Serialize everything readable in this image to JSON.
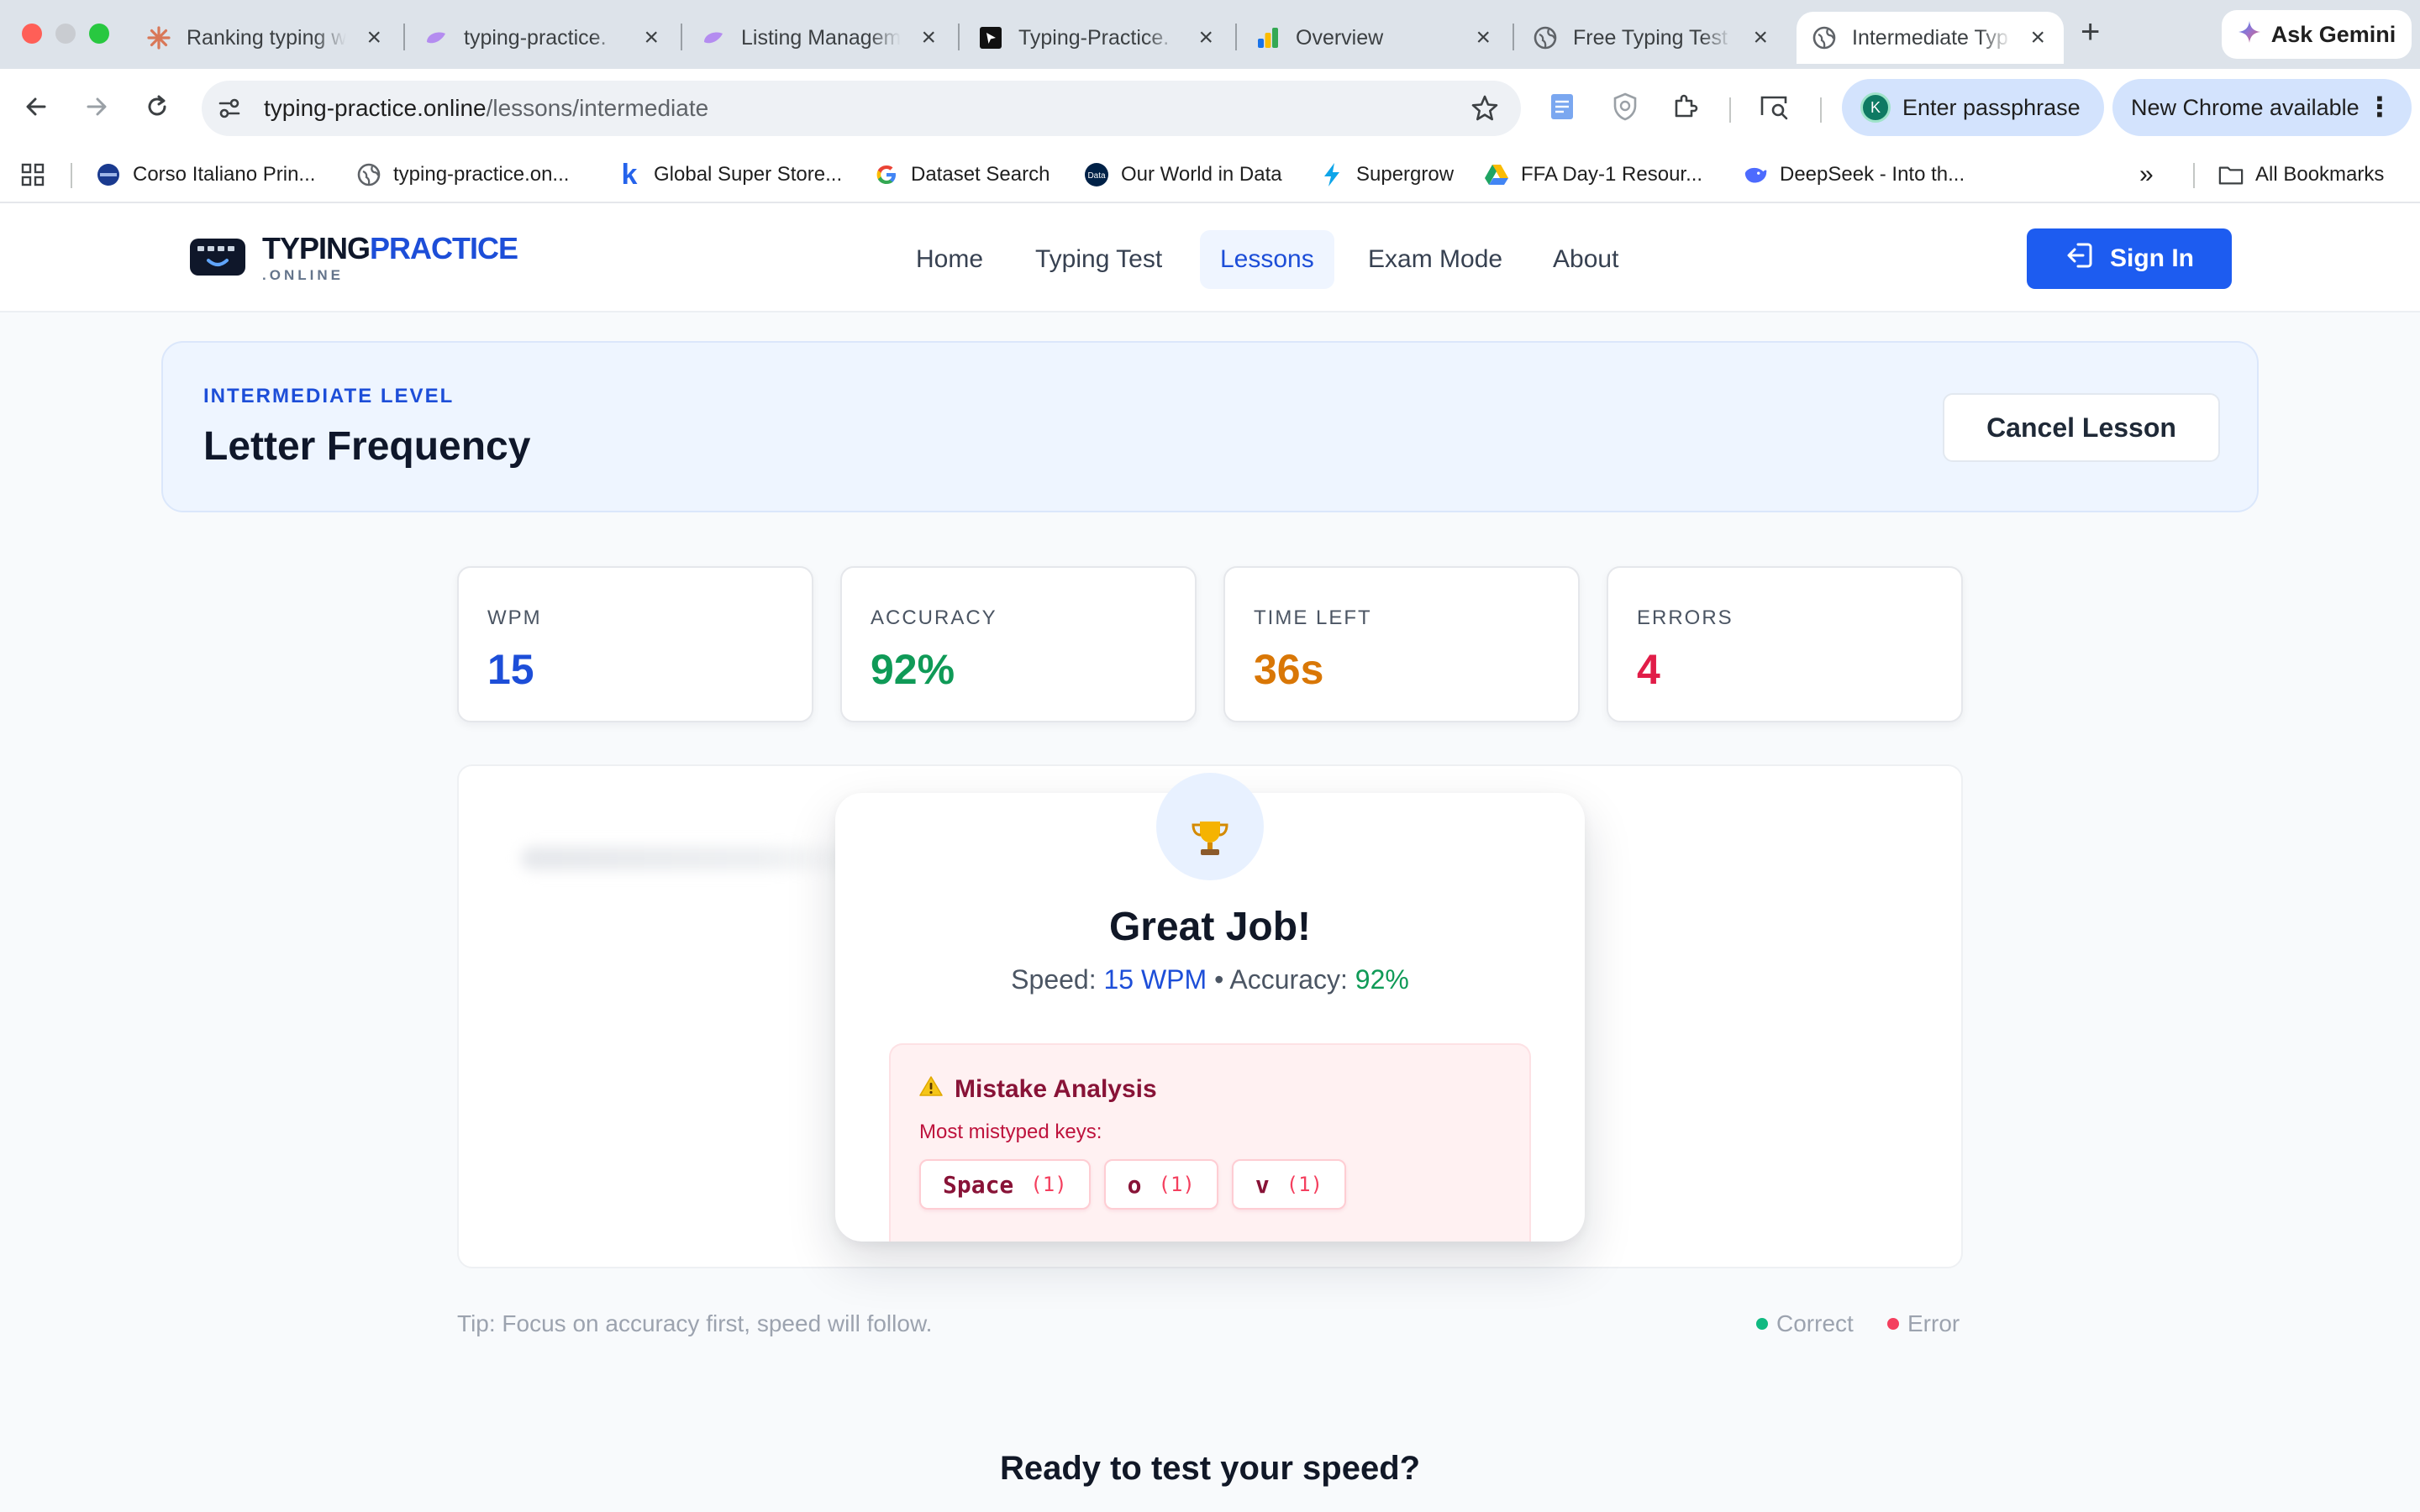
{
  "browser": {
    "tabs": [
      {
        "title": "Ranking typing w",
        "icon": "claude-burst-icon"
      },
      {
        "title": "typing-practice.",
        "icon": "lovable-icon"
      },
      {
        "title": "Listing Managem",
        "icon": "lovable-icon"
      },
      {
        "title": "Typing-Practice.",
        "icon": "cursor-icon"
      },
      {
        "title": "Overview",
        "icon": "analytics-icon"
      },
      {
        "title": "Free Typing Test",
        "icon": "globe-icon"
      },
      {
        "title": "Intermediate Typ",
        "icon": "globe-icon",
        "active": true
      }
    ],
    "gemini_label": "Ask Gemini",
    "url_host": "typing-practice.online",
    "url_path": "/lessons/intermediate",
    "passphrase_label": "Enter passphrase",
    "profile_initial": "K",
    "update_label": "New Chrome available",
    "bookmarks": [
      {
        "label": "Corso Italiano Prin...",
        "icon": "blue-circle-icon"
      },
      {
        "label": "typing-practice.on...",
        "icon": "globe-icon"
      },
      {
        "label": "Global Super Store...",
        "icon": "k-icon"
      },
      {
        "label": "Dataset Search",
        "icon": "google-icon"
      },
      {
        "label": "Our World in Data",
        "icon": "owid-icon"
      },
      {
        "label": "Supergrow",
        "icon": "bolt-icon"
      },
      {
        "label": "FFA Day-1 Resour...",
        "icon": "drive-icon"
      },
      {
        "label": "DeepSeek - Into th...",
        "icon": "whale-icon"
      }
    ],
    "all_bookmarks_label": "All Bookmarks"
  },
  "site": {
    "logo_part1": "TYPING",
    "logo_part2": "PRACTICE",
    "logo_sub": ".ONLINE",
    "nav": [
      "Home",
      "Typing Test",
      "Lessons",
      "Exam Mode",
      "About"
    ],
    "active_nav": "Lessons",
    "signin_label": "Sign In"
  },
  "lesson": {
    "level": "INTERMEDIATE LEVEL",
    "title": "Letter Frequency",
    "cancel_label": "Cancel Lesson"
  },
  "stats": [
    {
      "label": "WPM",
      "value": "15",
      "color": "#1d4ed8"
    },
    {
      "label": "ACCURACY",
      "value": "92%",
      "color": "#0f9a57"
    },
    {
      "label": "TIME LEFT",
      "value": "36s",
      "color": "#d97706"
    },
    {
      "label": "ERRORS",
      "value": "4",
      "color": "#e11d48"
    }
  ],
  "result": {
    "heading": "Great Job!",
    "speed_label": "Speed:",
    "speed_value": "15 WPM",
    "separator": "•",
    "accuracy_label": "Accuracy:",
    "accuracy_value": "92%",
    "mistake_title": "Mistake Analysis",
    "mistake_sub": "Most mistyped keys:",
    "keys": [
      {
        "key": "Space",
        "count": "(1)"
      },
      {
        "key": "o",
        "count": "(1)"
      },
      {
        "key": "v",
        "count": "(1)"
      }
    ]
  },
  "footer": {
    "tip": "Tip: Focus on accuracy first, speed will follow.",
    "legend_correct": "Correct",
    "legend_error": "Error",
    "legend_correct_color": "#10b981",
    "legend_error_color": "#f43f5e",
    "ready_heading": "Ready to test your speed?"
  }
}
